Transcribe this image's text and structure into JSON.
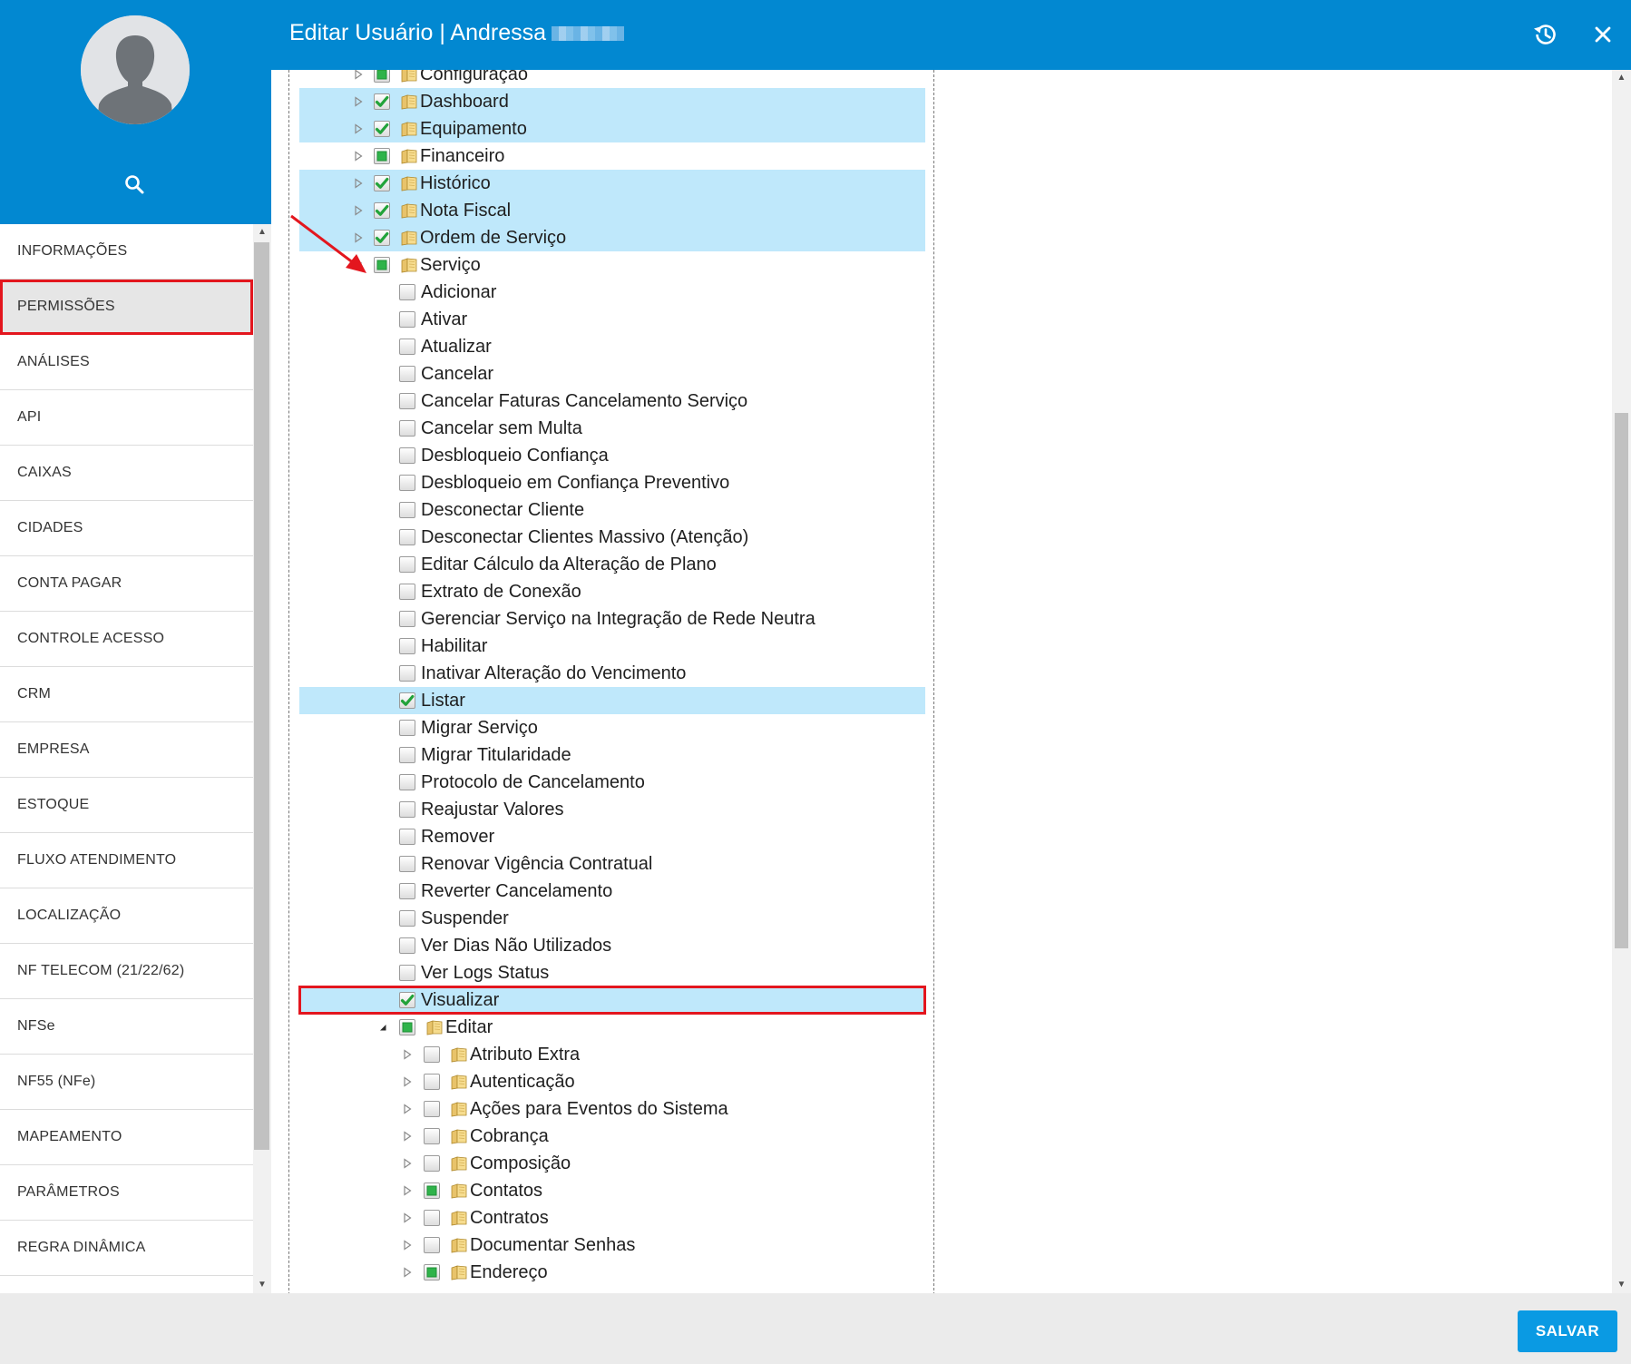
{
  "header": {
    "title": "Editar Usuário | Andressa",
    "history_icon": "history-icon",
    "close_icon": "close-icon",
    "color": "#0288d1"
  },
  "sidebar": {
    "avatar_icon": "user-avatar-icon",
    "search_icon": "search-icon",
    "items": [
      {
        "label": "INFORMAÇÕES",
        "active": false
      },
      {
        "label": "PERMISSÕES",
        "active": true
      },
      {
        "label": "ANÁLISES",
        "active": false
      },
      {
        "label": "API",
        "active": false
      },
      {
        "label": "CAIXAS",
        "active": false
      },
      {
        "label": "CIDADES",
        "active": false
      },
      {
        "label": "CONTA PAGAR",
        "active": false
      },
      {
        "label": "CONTROLE ACESSO",
        "active": false
      },
      {
        "label": "CRM",
        "active": false
      },
      {
        "label": "EMPRESA",
        "active": false
      },
      {
        "label": "ESTOQUE",
        "active": false
      },
      {
        "label": "FLUXO ATENDIMENTO",
        "active": false
      },
      {
        "label": "LOCALIZAÇÃO",
        "active": false
      },
      {
        "label": "NF TELECOM (21/22/62)",
        "active": false
      },
      {
        "label": "NFSe",
        "active": false
      },
      {
        "label": "NF55 (NFe)",
        "active": false
      },
      {
        "label": "MAPEAMENTO",
        "active": false
      },
      {
        "label": "PARÂMETROS",
        "active": false
      },
      {
        "label": "REGRA DINÂMICA",
        "active": false
      }
    ]
  },
  "tree": [
    {
      "label": "Configuração",
      "level": 0,
      "expander": "collapsed",
      "check": "partial",
      "folder": true,
      "highlight": false
    },
    {
      "label": "Dashboard",
      "level": 0,
      "expander": "collapsed",
      "check": "checked",
      "folder": true,
      "highlight": true
    },
    {
      "label": "Equipamento",
      "level": 0,
      "expander": "collapsed",
      "check": "checked",
      "folder": true,
      "highlight": true
    },
    {
      "label": "Financeiro",
      "level": 0,
      "expander": "collapsed",
      "check": "partial",
      "folder": true,
      "highlight": false
    },
    {
      "label": "Histórico",
      "level": 0,
      "expander": "collapsed",
      "check": "checked",
      "folder": true,
      "highlight": true
    },
    {
      "label": "Nota Fiscal",
      "level": 0,
      "expander": "collapsed",
      "check": "checked",
      "folder": true,
      "highlight": true
    },
    {
      "label": "Ordem de Serviço",
      "level": 0,
      "expander": "collapsed",
      "check": "checked",
      "folder": true,
      "highlight": true
    },
    {
      "label": "Serviço",
      "level": 0,
      "expander": "expanded",
      "check": "partial",
      "folder": true,
      "highlight": false
    },
    {
      "label": "Adicionar",
      "level": 1,
      "expander": "none",
      "check": "unchecked",
      "folder": false,
      "highlight": false
    },
    {
      "label": "Ativar",
      "level": 1,
      "expander": "none",
      "check": "unchecked",
      "folder": false,
      "highlight": false
    },
    {
      "label": "Atualizar",
      "level": 1,
      "expander": "none",
      "check": "unchecked",
      "folder": false,
      "highlight": false
    },
    {
      "label": "Cancelar",
      "level": 1,
      "expander": "none",
      "check": "unchecked",
      "folder": false,
      "highlight": false
    },
    {
      "label": "Cancelar Faturas Cancelamento Serviço",
      "level": 1,
      "expander": "none",
      "check": "unchecked",
      "folder": false,
      "highlight": false
    },
    {
      "label": "Cancelar sem Multa",
      "level": 1,
      "expander": "none",
      "check": "unchecked",
      "folder": false,
      "highlight": false
    },
    {
      "label": "Desbloqueio Confiança",
      "level": 1,
      "expander": "none",
      "check": "unchecked",
      "folder": false,
      "highlight": false
    },
    {
      "label": "Desbloqueio em Confiança Preventivo",
      "level": 1,
      "expander": "none",
      "check": "unchecked",
      "folder": false,
      "highlight": false
    },
    {
      "label": "Desconectar Cliente",
      "level": 1,
      "expander": "none",
      "check": "unchecked",
      "folder": false,
      "highlight": false
    },
    {
      "label": "Desconectar Clientes Massivo (Atenção)",
      "level": 1,
      "expander": "none",
      "check": "unchecked",
      "folder": false,
      "highlight": false
    },
    {
      "label": "Editar Cálculo da Alteração de Plano",
      "level": 1,
      "expander": "none",
      "check": "unchecked",
      "folder": false,
      "highlight": false
    },
    {
      "label": "Extrato de Conexão",
      "level": 1,
      "expander": "none",
      "check": "unchecked",
      "folder": false,
      "highlight": false
    },
    {
      "label": "Gerenciar Serviço na Integração de Rede Neutra",
      "level": 1,
      "expander": "none",
      "check": "unchecked",
      "folder": false,
      "highlight": false
    },
    {
      "label": "Habilitar",
      "level": 1,
      "expander": "none",
      "check": "unchecked",
      "folder": false,
      "highlight": false
    },
    {
      "label": "Inativar Alteração do Vencimento",
      "level": 1,
      "expander": "none",
      "check": "unchecked",
      "folder": false,
      "highlight": false
    },
    {
      "label": "Listar",
      "level": 1,
      "expander": "none",
      "check": "checked",
      "folder": false,
      "highlight": true
    },
    {
      "label": "Migrar Serviço",
      "level": 1,
      "expander": "none",
      "check": "unchecked",
      "folder": false,
      "highlight": false
    },
    {
      "label": "Migrar Titularidade",
      "level": 1,
      "expander": "none",
      "check": "unchecked",
      "folder": false,
      "highlight": false
    },
    {
      "label": "Protocolo de Cancelamento",
      "level": 1,
      "expander": "none",
      "check": "unchecked",
      "folder": false,
      "highlight": false
    },
    {
      "label": "Reajustar Valores",
      "level": 1,
      "expander": "none",
      "check": "unchecked",
      "folder": false,
      "highlight": false
    },
    {
      "label": "Remover",
      "level": 1,
      "expander": "none",
      "check": "unchecked",
      "folder": false,
      "highlight": false
    },
    {
      "label": "Renovar Vigência Contratual",
      "level": 1,
      "expander": "none",
      "check": "unchecked",
      "folder": false,
      "highlight": false
    },
    {
      "label": "Reverter Cancelamento",
      "level": 1,
      "expander": "none",
      "check": "unchecked",
      "folder": false,
      "highlight": false
    },
    {
      "label": "Suspender",
      "level": 1,
      "expander": "none",
      "check": "unchecked",
      "folder": false,
      "highlight": false
    },
    {
      "label": "Ver Dias Não Utilizados",
      "level": 1,
      "expander": "none",
      "check": "unchecked",
      "folder": false,
      "highlight": false
    },
    {
      "label": "Ver Logs Status",
      "level": 1,
      "expander": "none",
      "check": "unchecked",
      "folder": false,
      "highlight": false
    },
    {
      "label": "Visualizar",
      "level": 1,
      "expander": "none",
      "check": "checked",
      "folder": false,
      "highlight": true,
      "boxed": true
    },
    {
      "label": "Editar",
      "level": 1,
      "expander": "expanded",
      "check": "partial",
      "folder": true,
      "highlight": false
    },
    {
      "label": "Atributo Extra",
      "level": 2,
      "expander": "collapsed",
      "check": "unchecked",
      "folder": true,
      "highlight": false
    },
    {
      "label": "Autenticação",
      "level": 2,
      "expander": "collapsed",
      "check": "unchecked",
      "folder": true,
      "highlight": false
    },
    {
      "label": "Ações para Eventos do Sistema",
      "level": 2,
      "expander": "collapsed",
      "check": "unchecked",
      "folder": true,
      "highlight": false
    },
    {
      "label": "Cobrança",
      "level": 2,
      "expander": "collapsed",
      "check": "unchecked",
      "folder": true,
      "highlight": false
    },
    {
      "label": "Composição",
      "level": 2,
      "expander": "collapsed",
      "check": "unchecked",
      "folder": true,
      "highlight": false
    },
    {
      "label": "Contatos",
      "level": 2,
      "expander": "collapsed",
      "check": "partial",
      "folder": true,
      "highlight": false
    },
    {
      "label": "Contratos",
      "level": 2,
      "expander": "collapsed",
      "check": "unchecked",
      "folder": true,
      "highlight": false
    },
    {
      "label": "Documentar Senhas",
      "level": 2,
      "expander": "collapsed",
      "check": "unchecked",
      "folder": true,
      "highlight": false
    },
    {
      "label": "Endereço",
      "level": 2,
      "expander": "collapsed",
      "check": "partial",
      "folder": true,
      "highlight": false
    }
  ],
  "footer": {
    "save_label": "SALVAR",
    "save_color": "#0a9ae3"
  },
  "colors": {
    "highlight": "#bfe8fb",
    "annotation": "#e3161e"
  }
}
